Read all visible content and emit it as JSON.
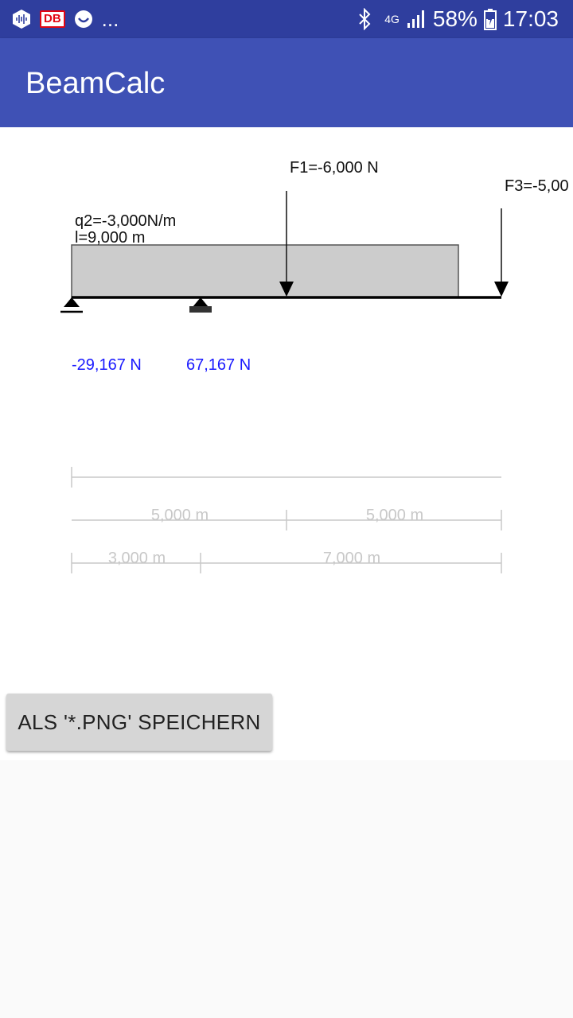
{
  "status_bar": {
    "left_icons": [
      "audio-wave-icon",
      "db-app-icon",
      "smiley-icon"
    ],
    "db_label": "DB",
    "overflow": "...",
    "network": "4G",
    "battery": "58%",
    "time": "17:03"
  },
  "app": {
    "title": "BeamCalc"
  },
  "beam": {
    "length_label": "l=9,000 m",
    "distributed_load_label": "q2=-3,000N/m",
    "force1_label": "F1=-6,000 N",
    "force3_label": "F3=-5,00",
    "reaction1": "-29,167 N",
    "reaction2": "67,167 N"
  },
  "dimensions": {
    "row2": [
      "5,000 m",
      "5,000 m"
    ],
    "row3": [
      "3,000 m",
      "7,000 m"
    ]
  },
  "colors": {
    "appbar": "#3f51b5",
    "statusbar": "#2f3e9e",
    "reaction_text": "#1a1aff",
    "load_fill": "#cccccc",
    "dimension": "#c8c8c8"
  },
  "actions": {
    "save_label": "ALS '*.PNG' SPEICHERN"
  }
}
